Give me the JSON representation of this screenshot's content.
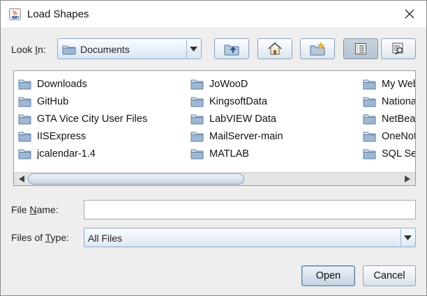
{
  "window": {
    "title": "Load Shapes"
  },
  "lookin": {
    "label_prefix": "Look ",
    "label_mnemonic": "I",
    "label_suffix": "n:",
    "value": "Documents"
  },
  "toolbar": {
    "buttons": [
      "up-one-level",
      "home",
      "create-new-folder",
      "list-view",
      "details-view"
    ],
    "pressed": "list-view"
  },
  "files": {
    "col1": [
      "Downloads",
      "GitHub",
      "GTA Vice City User Files",
      "IISExpress",
      "jcalendar-1.4"
    ],
    "col2": [
      "JoWooD",
      "KingsoftData",
      "LabVIEW Data",
      "MailServer-main",
      "MATLAB"
    ],
    "col3": [
      "My Web",
      "Nationa",
      "NetBea",
      "OneNot",
      "SQL Se"
    ]
  },
  "filename": {
    "label_prefix": "File ",
    "label_mnemonic": "N",
    "label_suffix": "ame:",
    "value": ""
  },
  "filetype": {
    "label_prefix": "Files of ",
    "label_mnemonic": "T",
    "label_suffix": "ype:",
    "value": "All Files"
  },
  "buttons": {
    "open": "Open",
    "cancel": "Cancel"
  },
  "colors": {
    "folder": "#5b7fa6",
    "accent": "#8aa9c9"
  }
}
